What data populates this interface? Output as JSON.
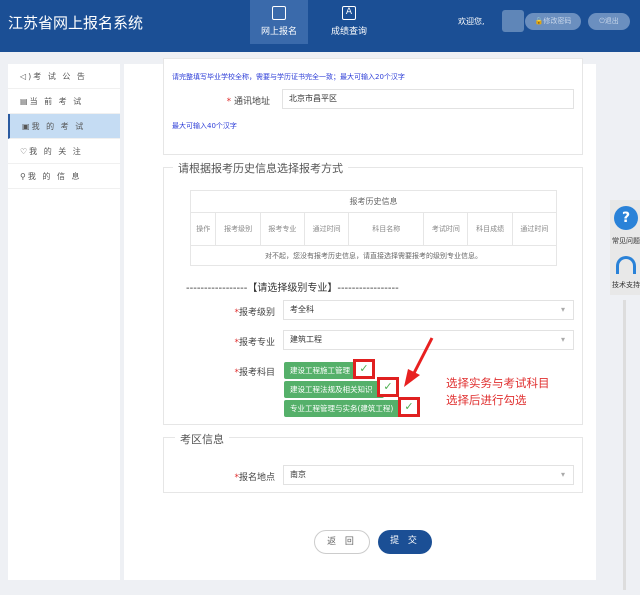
{
  "header": {
    "title": "江苏省网上报名系统",
    "nav": [
      {
        "label": "网上报名",
        "icon": "tablet-icon"
      },
      {
        "label": "成绩查询",
        "icon": "document-a-icon"
      }
    ],
    "welcome": "欢迎您,",
    "change_password": "🔒修改密码",
    "logout": "⏻退出"
  },
  "sidebar": {
    "items": [
      {
        "label": "考 试 公 告",
        "icon": "◁)"
      },
      {
        "label": "当 前 考 试",
        "icon": "▤"
      },
      {
        "label": "我 的 考 试",
        "icon": "▣"
      },
      {
        "label": "我 的 关 注",
        "icon": "♡"
      },
      {
        "label": "我 的 信 息",
        "icon": "⚲"
      }
    ]
  },
  "form": {
    "school_hint": "请完整填写毕业学校全称，需要与学历证书完全一致；最大可输入20个汉字",
    "address_label": "通讯地址",
    "address_value": "北京市昌平区",
    "address_hint": "最大可输入40个汉字",
    "history_legend": "请根据报考历史信息选择报考方式",
    "history_table": {
      "title": "报考历史信息",
      "headers": [
        "操作",
        "报考级别",
        "报考专业",
        "通过时间",
        "科目名称",
        "考试时间",
        "科目成绩",
        "通过时间"
      ],
      "empty": "对不起，您没有报考历史信息，请直接选择需要报考的级别专业信息。"
    },
    "select_title": "-----------------【请选择级别专业】-----------------",
    "level_label": "报考级别",
    "level_value": "考全科",
    "major_label": "报考专业",
    "major_value": "建筑工程",
    "subjects_label": "报考科目",
    "subjects": [
      "建设工程施工管理",
      "建设工程法规及相关知识",
      "专业工程管理与实务(建筑工程)"
    ],
    "annotation": [
      "选择实务与考试科目",
      "选择后进行勾选"
    ],
    "area_legend": "考区信息",
    "location_label": "报名地点",
    "location_value": "南京",
    "back": "返 回",
    "submit": "提 交"
  },
  "float": {
    "faq": "常见问题",
    "support": "技术支持"
  },
  "colors": {
    "header": "#1b4f95",
    "subject": "#55b06a",
    "annotation": "#e03030"
  }
}
